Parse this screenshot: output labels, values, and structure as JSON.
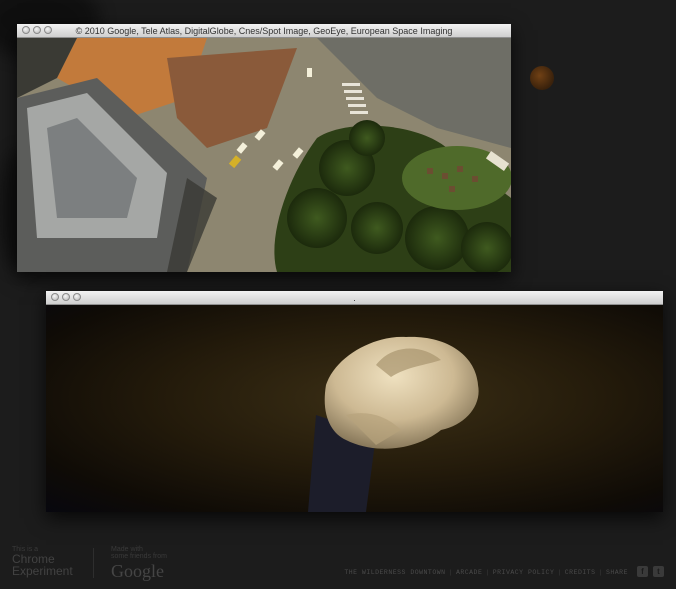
{
  "map_window": {
    "title": "© 2010 Google, Tele Atlas, DigitalGlobe, Cnes/Spot Image, GeoEye, European Space Imaging"
  },
  "video_window": {
    "title": "."
  },
  "footer": {
    "chrome_kicker": "This is a",
    "chrome_name_line1": "Chrome",
    "chrome_name_line2": "Experiment",
    "google_kicker_line1": "Made with",
    "google_kicker_line2": "some friends from",
    "google_wordmark": "Google",
    "links": [
      "THE WILDERNESS DOWNTOWN",
      "ARCADE",
      "PRIVACY POLICY",
      "CREDITS",
      "SHARE"
    ],
    "social": [
      {
        "icon": "facebook-icon",
        "glyph": "f"
      },
      {
        "icon": "twitter-icon",
        "glyph": "t"
      }
    ]
  },
  "colors": {
    "page_background": "#1c1c1c",
    "window_titlebar": "#e0e0e0",
    "footer_text": "#4a4a4a"
  }
}
